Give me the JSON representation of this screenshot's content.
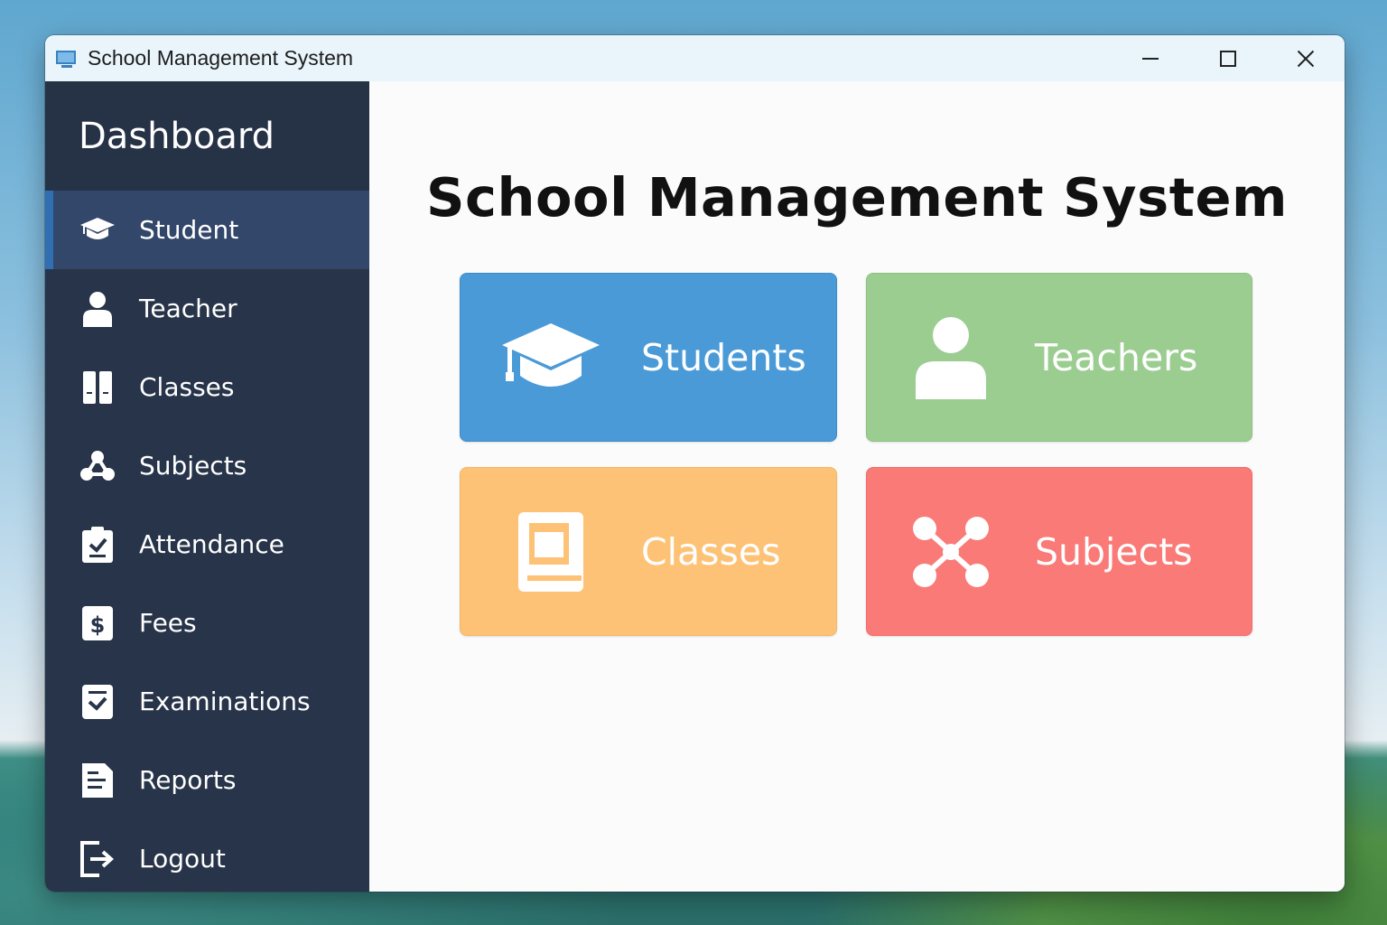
{
  "window": {
    "title": "School Management System"
  },
  "sidebar": {
    "header": "Dashboard",
    "items": [
      {
        "label": "Student",
        "icon": "graduation-cap-icon",
        "active": true
      },
      {
        "label": "Teacher",
        "icon": "person-icon"
      },
      {
        "label": "Classes",
        "icon": "books-icon"
      },
      {
        "label": "Subjects",
        "icon": "network-icon"
      },
      {
        "label": "Attendance",
        "icon": "clipboard-check-icon"
      },
      {
        "label": "Fees",
        "icon": "dollar-icon"
      },
      {
        "label": "Examinations",
        "icon": "checklist-icon"
      },
      {
        "label": "Reports",
        "icon": "report-icon"
      },
      {
        "label": "Logout",
        "icon": "logout-icon"
      }
    ]
  },
  "main": {
    "title": "School Management System",
    "cards": [
      {
        "label": "Students",
        "icon": "graduation-cap-icon",
        "color": "#4a9ad8"
      },
      {
        "label": "Teachers",
        "icon": "person-icon",
        "color": "#9bcd91"
      },
      {
        "label": "Classes",
        "icon": "book-icon",
        "color": "#fdc275"
      },
      {
        "label": "Subjects",
        "icon": "network-icon",
        "color": "#f97a77"
      }
    ]
  }
}
